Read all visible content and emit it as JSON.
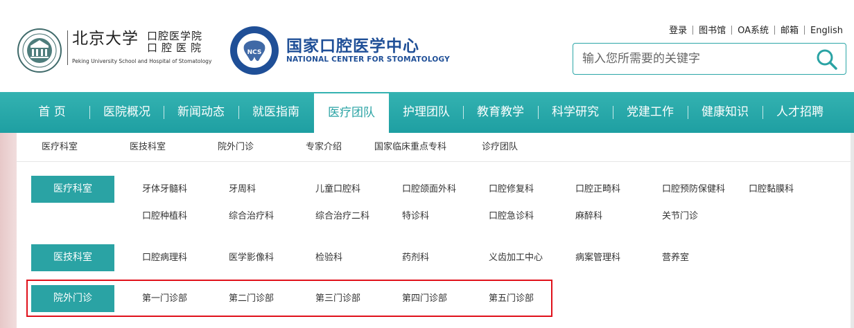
{
  "header": {
    "pku_name": "北京大学",
    "pku_dept_line1": "口腔医学院",
    "pku_dept_line2": "口腔医院",
    "pku_en": "Peking University School and Hospital of Stomatology",
    "ncs_name": "国家口腔医学中心",
    "ncs_en": "NATIONAL CENTER FOR STOMATOLOGY",
    "ncs_badge": "NCS",
    "top_links": [
      "登录",
      "图书馆",
      "OA系统",
      "邮箱",
      "English"
    ],
    "search_placeholder": "输入您所需要的关键字",
    "accent_color": "#2aa3a4"
  },
  "nav": {
    "items": [
      "首 页",
      "医院概况",
      "新闻动态",
      "就医指南",
      "医疗团队",
      "护理团队",
      "教育教学",
      "科学研究",
      "党建工作",
      "健康知识",
      "人才招聘"
    ],
    "active": "医疗团队"
  },
  "subnav": {
    "items": [
      "医疗科室",
      "医技科室",
      "院外门诊",
      "专家介绍",
      "国家临床重点专科",
      "诊疗团队"
    ]
  },
  "categories": [
    {
      "label": "医疗科室",
      "row1": [
        "牙体牙髓科",
        "牙周科",
        "儿童口腔科",
        "口腔颌面外科",
        "口腔修复科",
        "口腔正畸科",
        "口腔预防保健科",
        "口腔黏膜科"
      ],
      "row2": [
        "口腔种植科",
        "综合治疗科",
        "综合治疗二科",
        "特诊科",
        "口腔急诊科",
        "麻醉科",
        "关节门诊"
      ]
    },
    {
      "label": "医技科室",
      "row1": [
        "口腔病理科",
        "医学影像科",
        "检验科",
        "药剂科",
        "义齿加工中心",
        "病案管理科",
        "营养室"
      ]
    },
    {
      "label": "院外门诊",
      "row1": [
        "第一门诊部",
        "第二门诊部",
        "第三门诊部",
        "第四门诊部",
        "第五门诊部"
      ]
    }
  ],
  "highlight_color": "#e0101a"
}
